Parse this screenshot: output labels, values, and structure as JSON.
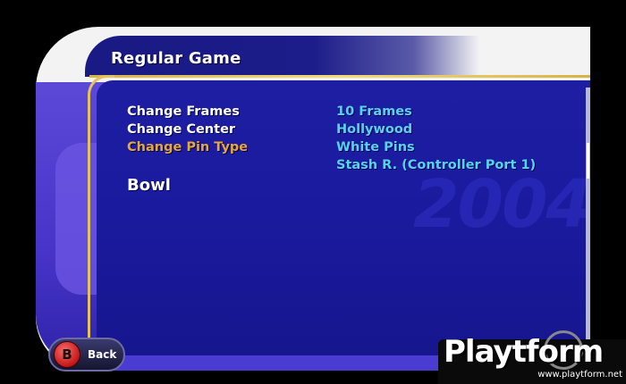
{
  "screen": {
    "title": "Regular Game",
    "watermark_year": "2004"
  },
  "menu": {
    "items": [
      {
        "label": "Change Frames",
        "value": "10 Frames",
        "selected": false
      },
      {
        "label": "Change Center",
        "value": "Hollywood",
        "selected": false
      },
      {
        "label": "Change Pin Type",
        "value": "White Pins",
        "selected": true
      }
    ],
    "player_value": "Stash R. (Controller Port 1)",
    "bowl_label": "Bowl"
  },
  "back_button": {
    "button_glyph": "B",
    "label": "Back"
  },
  "logo": {
    "text": "Playtform",
    "url": "www.playtform.net"
  },
  "colors": {
    "panel_blue": "#1e1ea2",
    "selected_orange": "#e6a63a",
    "value_cyan": "#57d3f0",
    "gold_trim": "#e2c35c"
  }
}
